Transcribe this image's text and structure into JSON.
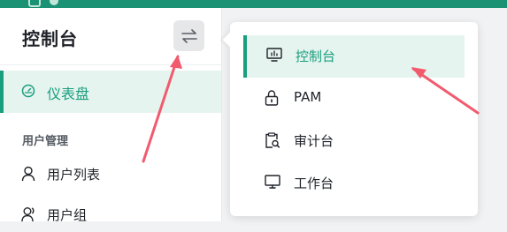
{
  "colors": {
    "accent": "#1a9e7e",
    "header": "#1a9273",
    "annotation": "#f25a6e"
  },
  "sidebar": {
    "title": "控制台",
    "switch_icon": "swap-arrows-icon",
    "active_item": {
      "label": "仪表盘",
      "icon": "dashboard-gauge-icon"
    },
    "group_title": "用户管理",
    "items": [
      {
        "label": "用户列表",
        "icon": "user-icon"
      },
      {
        "label": "用户组",
        "icon": "user-group-icon"
      }
    ]
  },
  "dropdown": {
    "items": [
      {
        "label": "控制台",
        "icon": "monitor-chart-icon",
        "active": true
      },
      {
        "label": "PAM",
        "icon": "lock-icon"
      },
      {
        "label": "审计台",
        "icon": "audit-clipboard-icon"
      },
      {
        "label": "工作台",
        "icon": "desktop-icon"
      }
    ]
  }
}
